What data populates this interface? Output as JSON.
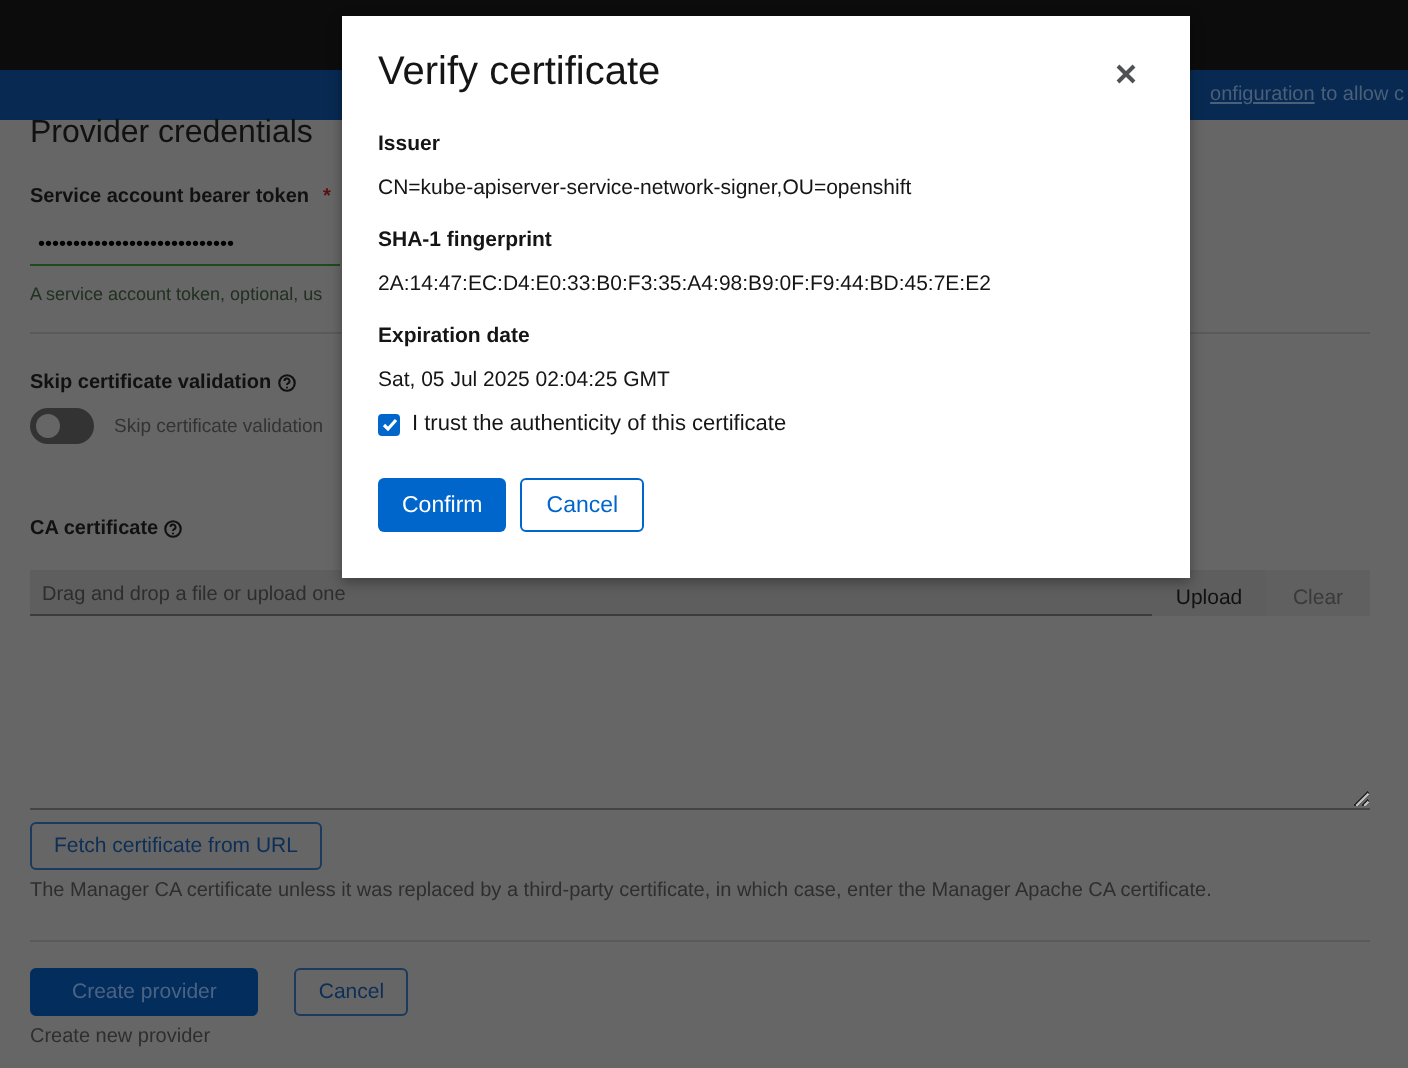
{
  "banner": {
    "link": "onfiguration",
    "text": " to allow c"
  },
  "form": {
    "title": "Provider credentials",
    "token": {
      "label": "Service account bearer token",
      "required_mark": "*",
      "value": "••••••••••••••••••••••••••••",
      "helper": "A service account token, optional, us"
    },
    "skip_validation": {
      "label": "Skip certificate validation",
      "on": false,
      "toggle_label": "Skip certificate validation"
    },
    "ca": {
      "label": "CA certificate",
      "placeholder": "Drag and drop a file or upload one",
      "upload": "Upload",
      "clear": "Clear",
      "fetch": "Fetch certificate from URL",
      "helper": "The Manager CA certificate unless it was replaced by a third-party certificate, in which case, enter the Manager Apache CA certificate."
    },
    "buttons": {
      "create": "Create provider",
      "cancel": "Cancel",
      "hint": "Create new provider"
    }
  },
  "dialog": {
    "title": "Verify certificate",
    "fields": [
      {
        "label": "Issuer",
        "value": "CN=kube-apiserver-service-network-signer,OU=openshift"
      },
      {
        "label": "SHA-1 fingerprint",
        "value": "2A:14:47:EC:D4:E0:33:B0:F3:35:A4:98:B9:0F:F9:44:BD:45:7E:E2"
      },
      {
        "label": "Expiration date",
        "value": "Sat, 05 Jul 2025 02:04:25 GMT"
      }
    ],
    "trust": {
      "label": "I trust the authenticity of this certificate",
      "checked": true
    },
    "confirm": "Confirm",
    "cancel": "Cancel"
  }
}
